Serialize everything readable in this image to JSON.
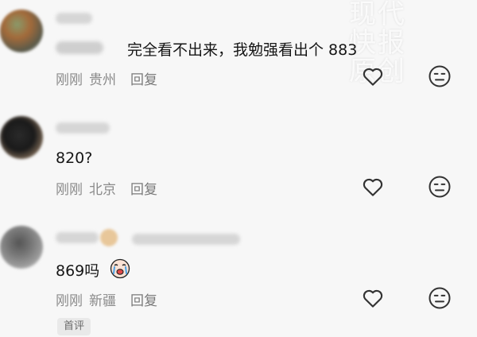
{
  "comments": [
    {
      "text": "完全看不出来，我勉强看出个 883",
      "time": "刚刚",
      "location": "贵州",
      "reply": "回复"
    },
    {
      "text": "820?",
      "time": "刚刚",
      "location": "北京",
      "reply": "回复"
    },
    {
      "text": "869吗",
      "time": "刚刚",
      "location": "新疆",
      "reply": "回复"
    }
  ],
  "badge": "首评",
  "watermark": [
    "现代",
    "快报",
    "原创"
  ],
  "colors": {
    "background": "#f7f7f7",
    "text": "#161616",
    "meta": "#8a8a8a"
  },
  "icons": [
    "like-icon",
    "dislike-icon",
    "crying-face-icon"
  ]
}
